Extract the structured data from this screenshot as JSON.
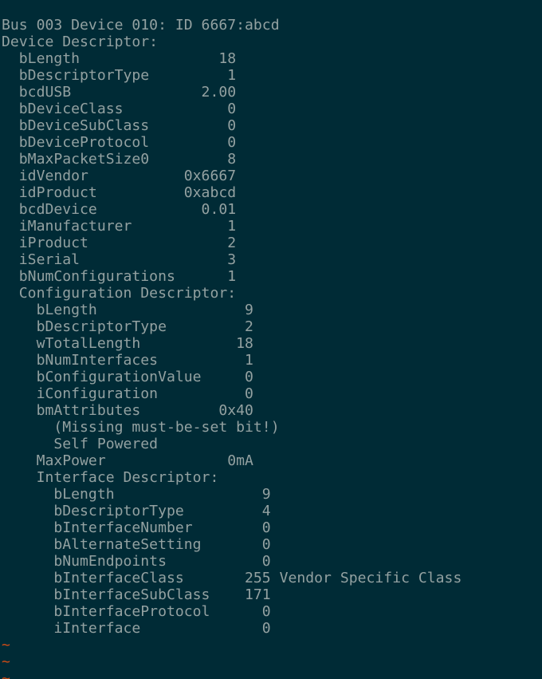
{
  "colors": {
    "background": "#002b36",
    "text": "#93a1a1",
    "tilde": "#cb4b16"
  },
  "lines": [
    "Bus 003 Device 010: ID 6667:abcd",
    "Device Descriptor:",
    "  bLength                18",
    "  bDescriptorType         1",
    "  bcdUSB               2.00",
    "  bDeviceClass            0",
    "  bDeviceSubClass         0",
    "  bDeviceProtocol         0",
    "  bMaxPacketSize0         8",
    "  idVendor           0x6667",
    "  idProduct          0xabcd",
    "  bcdDevice            0.01",
    "  iManufacturer           1",
    "  iProduct                2",
    "  iSerial                 3",
    "  bNumConfigurations      1",
    "  Configuration Descriptor:",
    "    bLength                 9",
    "    bDescriptorType         2",
    "    wTotalLength           18",
    "    bNumInterfaces          1",
    "    bConfigurationValue     0",
    "    iConfiguration          0",
    "    bmAttributes         0x40",
    "      (Missing must-be-set bit!)",
    "      Self Powered",
    "    MaxPower              0mA",
    "    Interface Descriptor:",
    "      bLength                 9",
    "      bDescriptorType         4",
    "      bInterfaceNumber        0",
    "      bAlternateSetting       0",
    "      bNumEndpoints           0",
    "      bInterfaceClass       255 Vendor Specific Class",
    "      bInterfaceSubClass    171",
    "      bInterfaceProtocol      0",
    "      iInterface              0"
  ],
  "tildes": [
    "~",
    "~",
    "~"
  ]
}
